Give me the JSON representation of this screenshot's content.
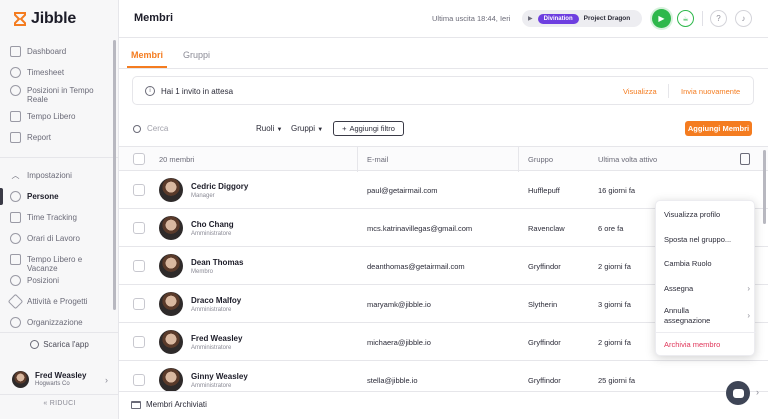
{
  "brand": {
    "name": "Jibble",
    "color": "#f47c20"
  },
  "sidebar": {
    "items": [
      {
        "label": "Dashboard",
        "icon": "dashboard-icon"
      },
      {
        "label": "Timesheet",
        "icon": "clock-icon"
      },
      {
        "label": "Posizioni in Tempo Reale",
        "icon": "location-pin-icon"
      },
      {
        "label": "Tempo Libero",
        "icon": "suitcase-icon"
      },
      {
        "label": "Report",
        "icon": "report-icon"
      }
    ],
    "settings_items": [
      {
        "label": "Impostazioni",
        "icon": "chevron-up-icon"
      },
      {
        "label": "Persone",
        "icon": "people-icon",
        "active": true
      },
      {
        "label": "Time Tracking",
        "icon": "time-tracking-icon"
      },
      {
        "label": "Orari di Lavoro",
        "icon": "work-schedule-icon"
      },
      {
        "label": "Tempo Libero e Vacanze",
        "icon": "suitcase-icon"
      },
      {
        "label": "Posizioni",
        "icon": "location-pin-icon"
      },
      {
        "label": "Attività e Progetti",
        "icon": "tag-icon"
      },
      {
        "label": "Organizzazione",
        "icon": "gear-icon"
      }
    ],
    "download_label": "Scarica l'app",
    "user": {
      "name": "Fred Weasley",
      "org": "Hogwarts Co"
    },
    "collapse_label": "RIDUCI"
  },
  "topbar": {
    "title": "Membri",
    "last_exit": "Ultima uscita 18:44, Ieri",
    "activity": "Divination",
    "project": "Project Dragon"
  },
  "tabs": [
    "Membri",
    "Gruppi"
  ],
  "invite": {
    "text": "Hai 1 invito in attesa",
    "view": "Visualizza",
    "resend": "Invia nuovamente"
  },
  "toolbar": {
    "search_placeholder": "Cerca",
    "roles": "Ruoli",
    "groups": "Gruppi",
    "add_filter": "Aggiungi filtro",
    "add_members": "Aggiungi Membri"
  },
  "table": {
    "headers": {
      "members": "20 membri",
      "email": "E-mail",
      "group": "Gruppo",
      "last_active": "Ultima volta attivo"
    },
    "rows": [
      {
        "name": "Cedric Diggory",
        "role": "Manager",
        "email": "paul@getairmail.com",
        "group": "Hufflepuff",
        "last": "16 giorni fa"
      },
      {
        "name": "Cho Chang",
        "role": "Amministratore",
        "email": "mcs.katrinavillegas@gmail.com",
        "group": "Ravenclaw",
        "last": "6 ore fa"
      },
      {
        "name": "Dean Thomas",
        "role": "Membro",
        "email": "deanthomas@getairmail.com",
        "group": "Gryffindor",
        "last": "2 giorni fa"
      },
      {
        "name": "Draco Malfoy",
        "role": "Amministratore",
        "email": "maryamk@jibble.io",
        "group": "Slytherin",
        "last": "3 giorni fa"
      },
      {
        "name": "Fred Weasley",
        "role": "Amministratore",
        "email": "michaera@jibble.io",
        "group": "Gryffindor",
        "last": "2 giorni fa"
      },
      {
        "name": "Ginny Weasley",
        "role": "Amministratore",
        "email": "stella@jibble.io",
        "group": "Gryffindor",
        "last": "25 giorni fa"
      }
    ]
  },
  "context_menu": {
    "view_profile": "Visualizza profilo",
    "move_group": "Sposta nel gruppo...",
    "change_role": "Cambia Ruolo",
    "assign": "Assegna",
    "unassign": "Annulla assegnazione",
    "archive": "Archivia membro"
  },
  "footer": {
    "archived": "Membri Archiviati"
  },
  "colors": {
    "accent": "#f47c20",
    "success": "#2eb84b",
    "activity_pill": "#6e3fe0",
    "danger": "#e0365a"
  }
}
